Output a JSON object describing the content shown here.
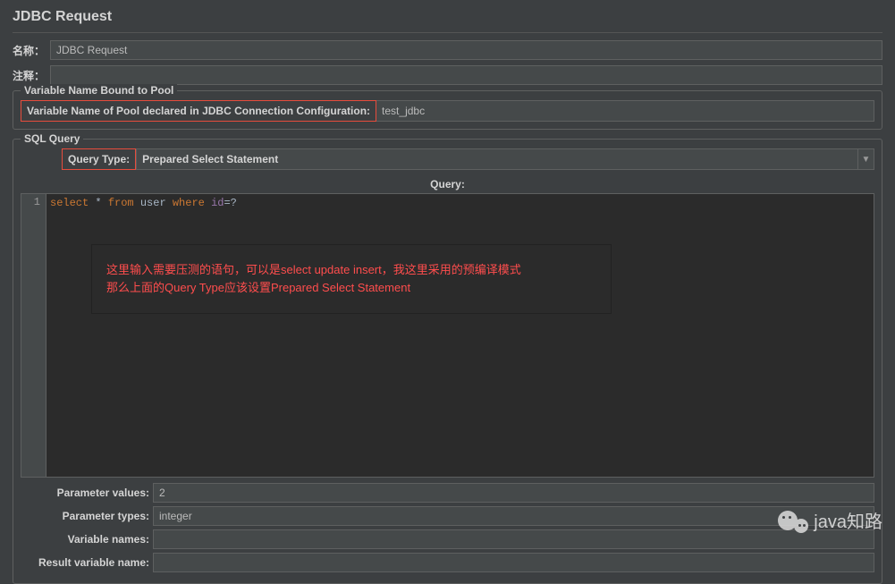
{
  "title": "JDBC Request",
  "fields": {
    "name_label": "名称：",
    "name_value": "JDBC Request",
    "comment_label": "注释："
  },
  "pool": {
    "legend": "Variable Name Bound to Pool",
    "label": "Variable Name of Pool declared in JDBC Connection Configuration:",
    "value": "test_jdbc"
  },
  "sql": {
    "legend": "SQL Query",
    "query_type_label": "Query Type:",
    "query_type_value": "Prepared Select Statement",
    "query_header": "Query:",
    "line_number": "1",
    "code": {
      "kw1": "select",
      "star": "*",
      "kw2": "from",
      "tbl": "user",
      "kw3": "where",
      "col": "id",
      "rest": "=?"
    },
    "annotation_line1": "这里输入需要压测的语句，可以是select update insert，我这里采用的预编译模式",
    "annotation_line2": "那么上面的Query Type应该设置Prepared Select Statement"
  },
  "params": {
    "parameter_values_label": "Parameter values:",
    "parameter_values": "2",
    "parameter_types_label": "Parameter types:",
    "parameter_types": "integer",
    "variable_names_label": "Variable names:",
    "variable_names": "",
    "result_variable_name_label": "Result variable name:",
    "result_variable_name": ""
  },
  "watermark": "java知路"
}
